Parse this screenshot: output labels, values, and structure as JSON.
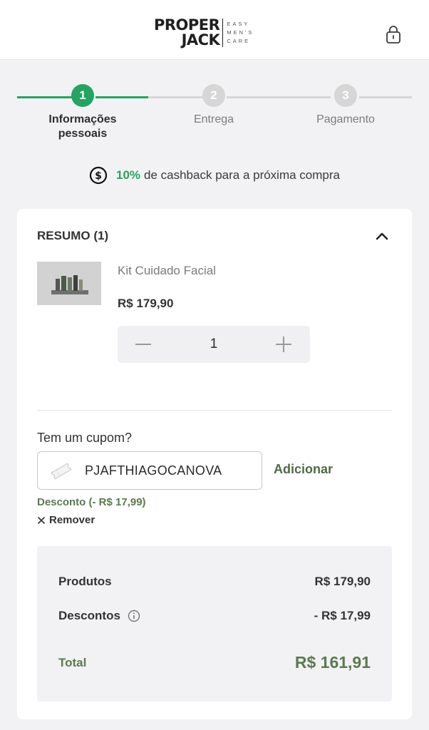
{
  "brand": {
    "name_line1": "PROPER",
    "name_line2": "JACK",
    "tagline1": "EASY",
    "tagline2": "MEN'S",
    "tagline3": "CARE"
  },
  "steps": [
    {
      "number": "1",
      "label_line1": "Informações",
      "label_line2": "pessoais",
      "state": "active"
    },
    {
      "number": "2",
      "label_line1": "Entrega",
      "label_line2": "",
      "state": "inactive"
    },
    {
      "number": "3",
      "label_line1": "Pagamento",
      "label_line2": "",
      "state": "inactive"
    }
  ],
  "cashback": {
    "percent": "10%",
    "text": "de cashback para a próxima compra"
  },
  "summary": {
    "title": "RESUMO (1)",
    "item": {
      "name": "Kit Cuidado Facial",
      "price": "R$ 179,90",
      "quantity": "1"
    }
  },
  "coupon": {
    "question": "Tem um cupom?",
    "value": "PJAFTHIAGOCANOVA",
    "add_label": "Adicionar",
    "discount_text": "Desconto (- R$ 17,99)",
    "remove_label": "Remover"
  },
  "totals": {
    "products_label": "Produtos",
    "products_value": "R$ 179,90",
    "discounts_label": "Descontos",
    "discounts_value": "- R$ 17,99",
    "total_label": "Total",
    "total_value": "R$ 161,91"
  },
  "colors": {
    "accent_green": "#23a55f",
    "olive_green": "#5b7a4e",
    "inactive_gray": "#d6d6d6",
    "background": "#f2f2f4"
  }
}
